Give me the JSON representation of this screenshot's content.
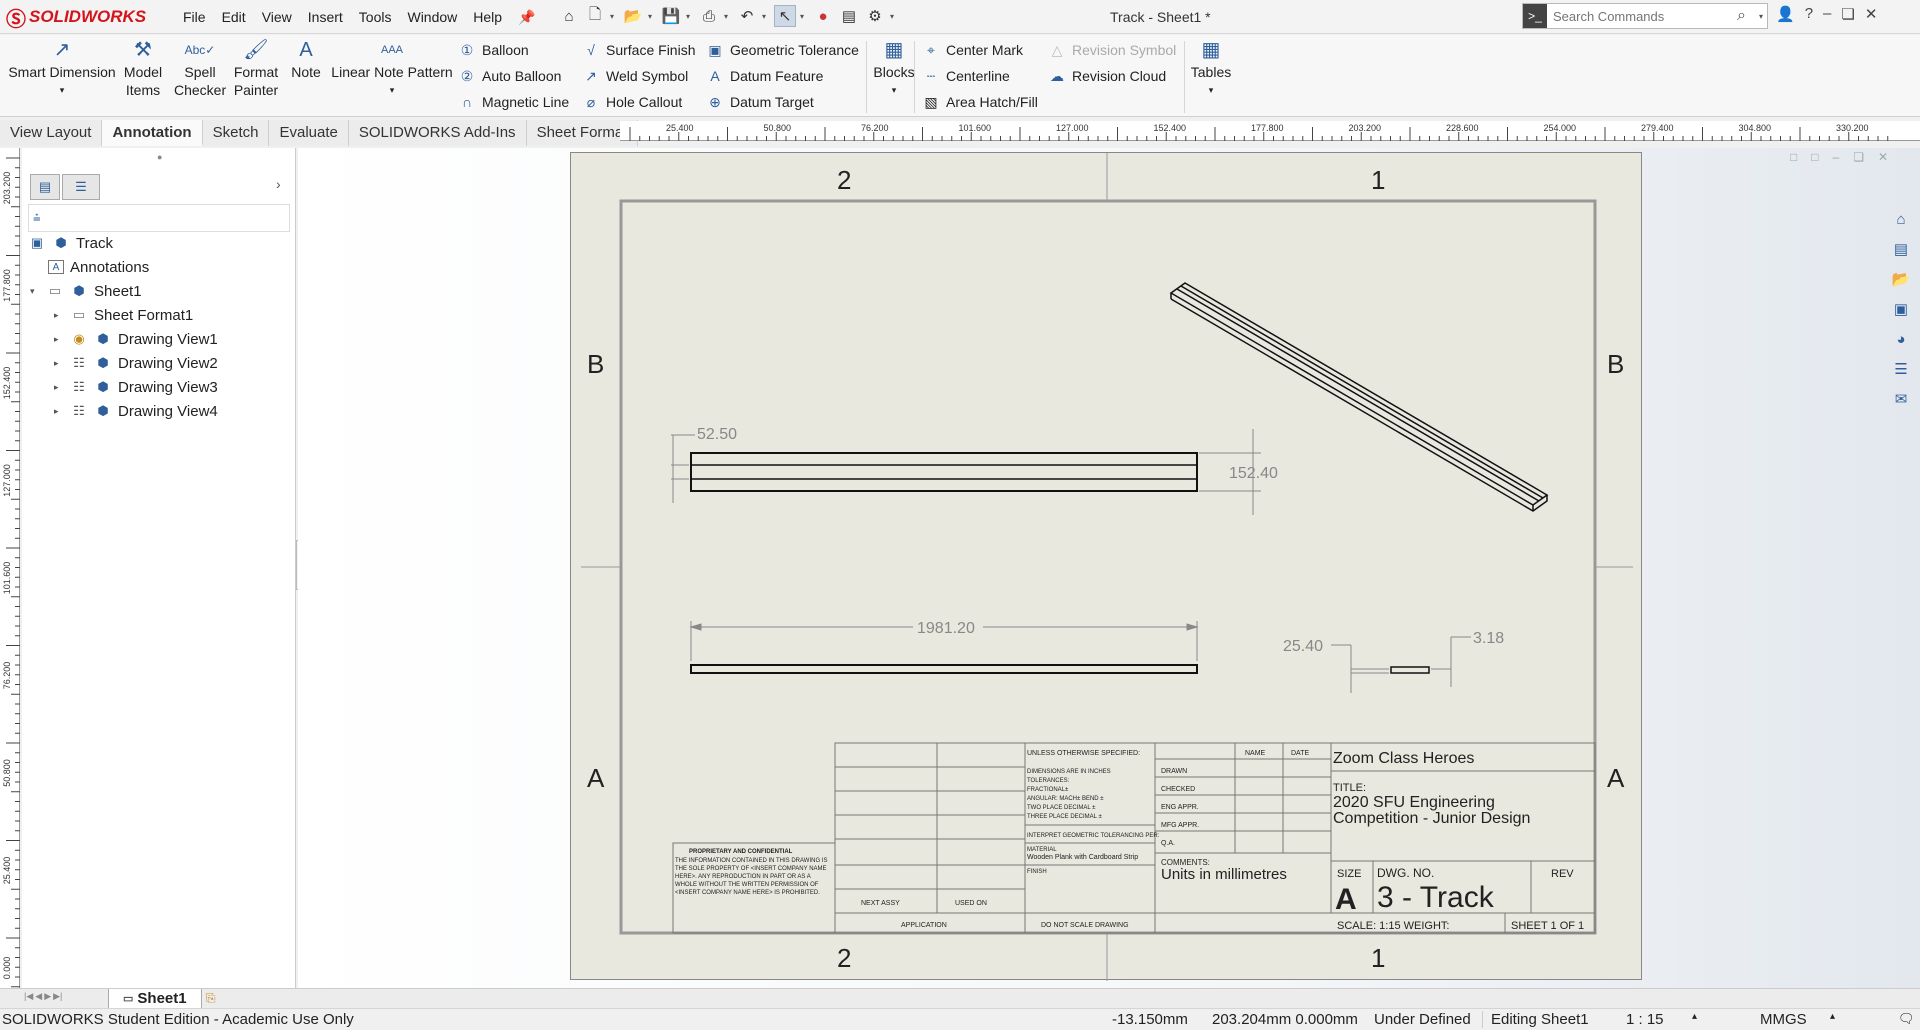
{
  "app": {
    "name": "SOLIDWORKS",
    "logo": "3DS SOLIDWORKS",
    "doc_title": "Track - Sheet1 *"
  },
  "menu": [
    "File",
    "Edit",
    "View",
    "Insert",
    "Tools",
    "Window",
    "Help"
  ],
  "search": {
    "placeholder": "Search Commands"
  },
  "ribbon": {
    "smart_dimension": "Smart Dimension",
    "model_items": "Model Items",
    "spell_checker": "Spell Checker",
    "format_painter": "Format Painter",
    "note": "Note",
    "linear_note_pattern": "Linear Note Pattern",
    "balloon": "Balloon",
    "auto_balloon": "Auto Balloon",
    "magnetic_line": "Magnetic Line",
    "surface_finish": "Surface Finish",
    "weld_symbol": "Weld Symbol",
    "hole_callout": "Hole Callout",
    "geometric_tolerance": "Geometric Tolerance",
    "datum_feature": "Datum Feature",
    "datum_target": "Datum Target",
    "blocks": "Blocks",
    "center_mark": "Center Mark",
    "centerline": "Centerline",
    "area_hatch": "Area Hatch/Fill",
    "revision_symbol": "Revision Symbol",
    "revision_cloud": "Revision Cloud",
    "tables": "Tables"
  },
  "tabs": [
    "View Layout",
    "Annotation",
    "Sketch",
    "Evaluate",
    "SOLIDWORKS Add-Ins",
    "Sheet Format"
  ],
  "active_tab": "Annotation",
  "hruler_labels": [
    "25.400",
    "50.800",
    "76.200",
    "101.600",
    "127.000",
    "152.400",
    "177.800",
    "203.200",
    "228.600",
    "254.000",
    "279.400",
    "304.800",
    "330.200"
  ],
  "vruler_labels": [
    "203.200",
    "177.800",
    "152.400",
    "127.000",
    "101.600",
    "76.200",
    "50.800",
    "25.400",
    "0.000"
  ],
  "tree": {
    "root": "Track",
    "annotations": "Annotations",
    "sheet": "Sheet1",
    "sheet_format": "Sheet Format1",
    "views": [
      "Drawing View1",
      "Drawing View2",
      "Drawing View3",
      "Drawing View4"
    ]
  },
  "drawing": {
    "zone_top": [
      "2",
      "1"
    ],
    "zone_side": [
      "B",
      "A"
    ],
    "dims": {
      "width": "52.50",
      "height": "152.40",
      "length": "1981.20",
      "thick": "25.40",
      "depth": "3.18"
    },
    "title_block": {
      "company": "Zoom Class Heroes",
      "title_label": "TITLE:",
      "title": "2020 SFU Engineering Competition - Junior Design",
      "size_label": "SIZE",
      "size": "A",
      "dwg_no_label": "DWG.  NO.",
      "dwg_no": "3 -  Track",
      "rev_label": "REV",
      "scale": "SCALE: 1:15  WEIGHT:",
      "sheet": "SHEET 1 OF 1",
      "comments_label": "COMMENTS:",
      "comments": "Units in millimetres",
      "unless": "UNLESS OTHERWISE SPECIFIED:",
      "name_label": "NAME",
      "date_label": "DATE",
      "drawn": "DRAWN",
      "checked": "CHECKED",
      "eng_appr": "ENG APPR.",
      "mfg_appr": "MFG APPR.",
      "qa": "Q.A.",
      "dims_text": "DIMENSIONS ARE IN INCHES",
      "tolerances": "TOLERANCES:",
      "fractional": "FRACTIONAL±",
      "angular": "ANGULAR: MACH±   BEND ±",
      "two_place": "TWO PLACE DECIMAL   ±",
      "three_place": "THREE PLACE DECIMAL  ±",
      "interpret": "INTERPRET GEOMETRIC TOLERANCING PER:",
      "material_label": "MATERIAL",
      "material": "Wooden Plank with Cardboard Strip",
      "finish": "FINISH",
      "next_assy": "NEXT ASSY",
      "used_on": "USED ON",
      "application": "APPLICATION",
      "do_not_scale": "DO NOT SCALE DRAWING",
      "proprietary_title": "PROPRIETARY AND CONFIDENTIAL",
      "proprietary_text": "THE INFORMATION CONTAINED IN THIS DRAWING IS THE SOLE PROPERTY OF <INSERT COMPANY NAME HERE>. ANY REPRODUCTION IN PART OR AS A WHOLE WITHOUT THE WRITTEN PERMISSION OF <INSERT COMPANY NAME HERE> IS PROHIBITED."
    }
  },
  "sheet_tab": "Sheet1",
  "status": {
    "edition": "SOLIDWORKS Student Edition - Academic Use Only",
    "x": "-13.150mm",
    "y": "203.204mm 0.000mm",
    "defined": "Under Defined",
    "editing": "Editing Sheet1",
    "scale": "1 : 15",
    "units": "MMGS"
  }
}
